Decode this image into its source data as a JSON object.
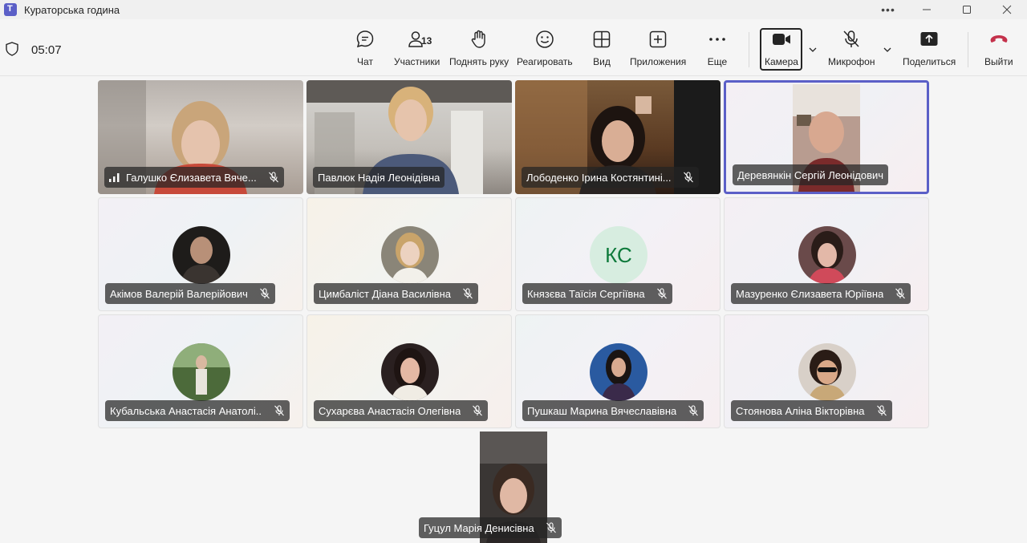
{
  "window": {
    "title": "Кураторська година",
    "more_label": "•••"
  },
  "meeting": {
    "timer": "05:07"
  },
  "toolbar": {
    "chat": "Чат",
    "participants": "Участники",
    "participants_count": "13",
    "raise_hand": "Поднять руку",
    "react": "Реагировать",
    "view": "Вид",
    "apps": "Приложения",
    "more": "Еще",
    "camera": "Камера",
    "mic": "Микрофон",
    "share": "Поделиться",
    "leave": "Выйти"
  },
  "colors": {
    "accent": "#5b5fc7",
    "leave": "#c4314b",
    "initials_bg": "#d7ede0",
    "initials_fg": "#0e7a3b"
  },
  "participants": [
    {
      "name": "Галушко Єлизавета Вяче...",
      "muted": true,
      "video": true
    },
    {
      "name": "Павлюк Надія Леонідівна",
      "muted": false,
      "video": true
    },
    {
      "name": "Лободенко Ірина Костянтині...",
      "muted": true,
      "video": true
    },
    {
      "name": "Деревянкін Сергій Леонідович",
      "muted": false,
      "video": true,
      "active_speaker": true
    },
    {
      "name": "Акімов Валерій Валерійович",
      "muted": true,
      "video": false
    },
    {
      "name": "Цимбаліст Діана Василівна",
      "muted": true,
      "video": false
    },
    {
      "name": "Князєва Таїсія Сергіївна",
      "muted": true,
      "video": false,
      "initials": "КС"
    },
    {
      "name": "Мазуренко Єлизавета Юріївна",
      "muted": true,
      "video": false
    },
    {
      "name": "Кубальська Анастасія Анатолі...",
      "muted": true,
      "video": false
    },
    {
      "name": "Сухарєва Анастасія Олегівна",
      "muted": true,
      "video": false
    },
    {
      "name": "Пушкаш Марина Вячеславівна",
      "muted": true,
      "video": false
    },
    {
      "name": "Стоянова Аліна Вікторівна",
      "muted": true,
      "video": false
    }
  ],
  "self": {
    "name": "Гуцул Марія Денисівна",
    "muted": true
  }
}
